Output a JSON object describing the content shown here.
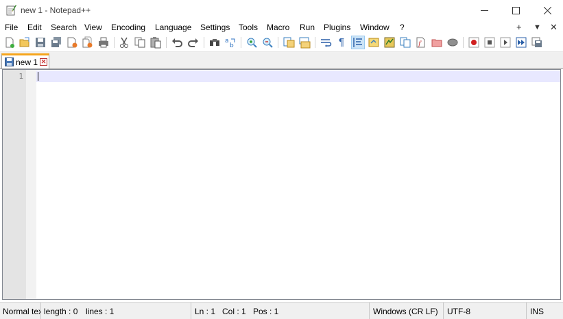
{
  "window": {
    "title": "new 1 - Notepad++",
    "minimize_icon": "minimize-icon",
    "maximize_icon": "maximize-icon",
    "close_icon": "close-icon"
  },
  "menu": {
    "items": [
      "File",
      "Edit",
      "Search",
      "View",
      "Encoding",
      "Language",
      "Settings",
      "Tools",
      "Macro",
      "Run",
      "Plugins",
      "Window",
      "?"
    ],
    "right_plus": "+",
    "right_down": "▼",
    "right_close": "✕"
  },
  "toolbar": {
    "icons": [
      "new-file-icon",
      "open-file-icon",
      "save-icon",
      "save-all-icon",
      "close-icon",
      "close-all-icon",
      "print-icon",
      "cut-icon",
      "copy-icon",
      "paste-icon",
      "undo-icon",
      "redo-icon",
      "find-icon",
      "replace-icon",
      "zoom-in-icon",
      "zoom-out-icon",
      "sync-vertical-icon",
      "sync-horizontal-icon",
      "word-wrap-icon",
      "show-all-characters-icon",
      "indent-guide-icon",
      "user-defined-language-icon",
      "document-map-icon",
      "document-list-icon",
      "function-list-icon",
      "folder-as-workspace-icon",
      "monitoring-icon",
      "record-macro-icon",
      "stop-recording-icon",
      "playback-macro-icon",
      "run-macro-multiple-icon",
      "save-macro-icon"
    ],
    "pilcrow": "¶"
  },
  "tabs": [
    {
      "label": "new 1",
      "close": "✕"
    }
  ],
  "editor": {
    "line_numbers": [
      "1"
    ]
  },
  "status": {
    "language": "Normal text file",
    "length": "length : 0",
    "lines": "lines : 1",
    "ln": "Ln : 1",
    "col": "Col : 1",
    "pos": "Pos : 1",
    "eol": "Windows (CR LF)",
    "encoding": "UTF-8",
    "mode": "INS"
  },
  "colors": {
    "tab_accent": "#f6a51b",
    "current_line": "#e8e8ff",
    "gutter": "#e4e4e4",
    "toolbar_active": "#cce4f7"
  }
}
